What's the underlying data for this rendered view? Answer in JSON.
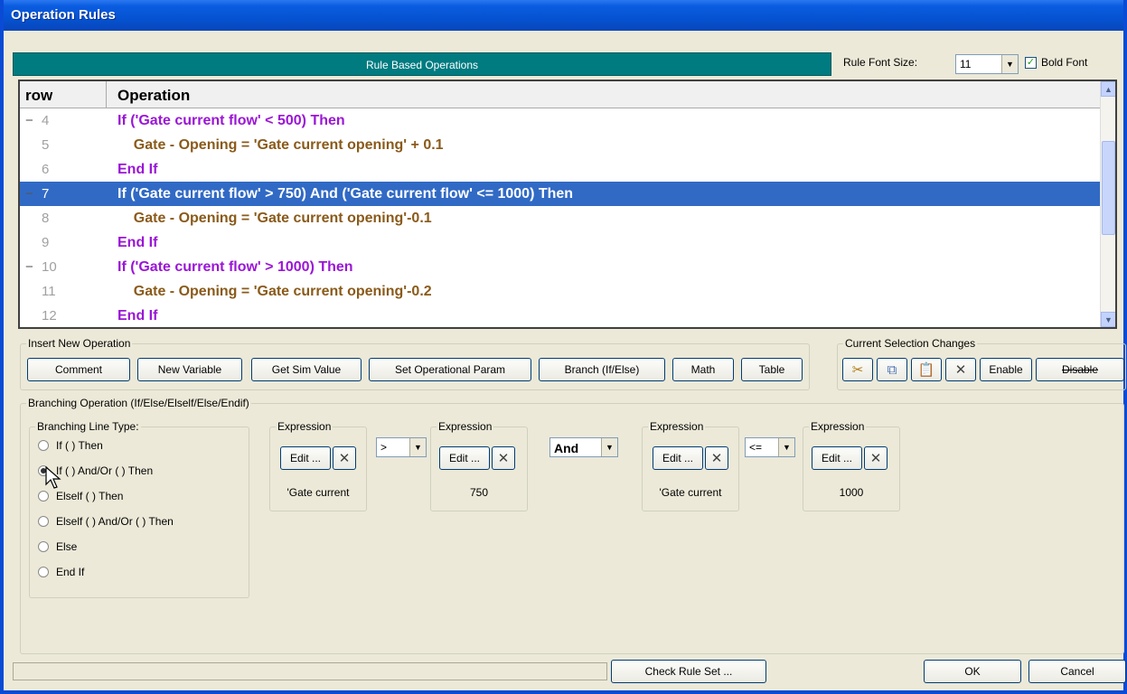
{
  "window": {
    "title": "Operation Rules"
  },
  "header": {
    "panel_title": "Rule Based Operations",
    "font_size_label": "Rule Font Size:",
    "font_size_value": "11",
    "bold_label": "Bold Font",
    "bold_checked": true
  },
  "grid": {
    "col_row": "row",
    "col_operation": "Operation",
    "rows": [
      {
        "num": "4",
        "collapse": "−",
        "text": "If ('Gate current flow' < 500) Then",
        "color": "purple"
      },
      {
        "num": "5",
        "collapse": "",
        "text": "    Gate - Opening = 'Gate current opening' + 0.1",
        "color": "brown"
      },
      {
        "num": "6",
        "collapse": "",
        "text": "End If",
        "color": "purple"
      },
      {
        "num": "7",
        "collapse": "−",
        "text": "If ('Gate current flow' > 750) And ('Gate current flow' <= 1000) Then",
        "color": "purple",
        "selected": true
      },
      {
        "num": "8",
        "collapse": "",
        "text": "    Gate - Opening = 'Gate current opening'-0.1",
        "color": "brown"
      },
      {
        "num": "9",
        "collapse": "",
        "text": "End If",
        "color": "purple"
      },
      {
        "num": "10",
        "collapse": "−",
        "text": "If ('Gate current flow' > 1000) Then",
        "color": "purple"
      },
      {
        "num": "11",
        "collapse": "",
        "text": "    Gate - Opening = 'Gate current opening'-0.2",
        "color": "brown"
      },
      {
        "num": "12",
        "collapse": "",
        "text": "End If",
        "color": "purple"
      }
    ]
  },
  "insert": {
    "legend": "Insert New Operation",
    "buttons": [
      "Comment",
      "New Variable",
      "Get Sim Value",
      "Set Operational Param",
      "Branch (If/Else)",
      "Math",
      "Table"
    ]
  },
  "selection": {
    "legend": "Current Selection Changes",
    "enable": "Enable",
    "disable": "Disable"
  },
  "branching": {
    "legend": "Branching Operation (If/Else/Elself/Else/Endif)",
    "line_type_legend": "Branching Line Type:",
    "options": [
      "If ( ) Then",
      "If ( ) And/Or ( ) Then",
      "Elself ( ) Then",
      "Elself ( ) And/Or ( ) Then",
      "Else",
      "End If"
    ],
    "selected_index": 1,
    "expression_label": "Expression",
    "edit_label": "Edit ...",
    "expr1_value": "'Gate current",
    "op1": ">",
    "expr2_value": "750",
    "conjunction": "And",
    "expr3_value": "'Gate current",
    "op2": "<=",
    "expr4_value": "1000"
  },
  "footer": {
    "check": "Check Rule Set ...",
    "ok": "OK",
    "cancel": "Cancel"
  }
}
